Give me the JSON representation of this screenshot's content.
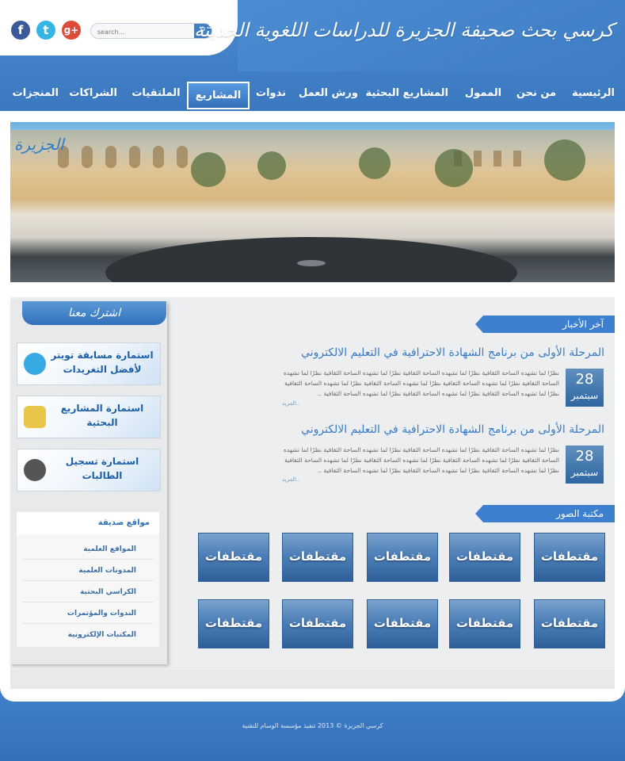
{
  "header": {
    "site_title": "كرسي بحث صحيفة الجزيرة للدراسات اللغوية الحديثة",
    "search_placeholder": "search...",
    "social": {
      "facebook": "f",
      "twitter": "t",
      "googleplus": "g+"
    }
  },
  "nav": {
    "items": [
      {
        "label": "الرئيسية"
      },
      {
        "label": "من نحن"
      },
      {
        "label": "الممول"
      },
      {
        "label": "المشاريع البحثية"
      },
      {
        "label": "ورش العمل"
      },
      {
        "label": "ندوات"
      },
      {
        "label": "المشاريع",
        "active": true
      },
      {
        "label": "الملتقيات"
      },
      {
        "label": "الشراكات"
      },
      {
        "label": "المنجزات"
      }
    ]
  },
  "banner": {
    "logo_text": "الجزيرة"
  },
  "sidebar": {
    "subscribe_label": "اشترك معنا",
    "promos": [
      {
        "text": "استمارة مسابقة تويتر لأفضل التغريدات",
        "icon": "twitter-bird-icon"
      },
      {
        "text": "استمارة المشاريع البحثية",
        "icon": "folder-icon"
      },
      {
        "text": "استمارة تسجيل الطالبات",
        "icon": "film-reel-icon"
      }
    ],
    "links_title": "مواقع صديقة",
    "links": [
      "المواقع العلمية",
      "المدونات العلمية",
      "الكراسي البحثية",
      "الندوات والمؤتمرات",
      "المكتبات الإلكترونية"
    ]
  },
  "news": {
    "section_title": "آخر الأخبار",
    "more_label": "المزيد..",
    "items": [
      {
        "title": "المرحلة الأولى من برنامج الشهادة الاحترافية في التعليم الالكتروني",
        "text": "نظرًا لما تشهده الساحة الثقافية  نظرًا لما تشهده الساحة الثقافية  نظرًا لما تشهده الساحة الثقافية  نظرًا لما تشهده الساحة الثقافية  نظرًا لما تشهده الساحة الثقافية  نظرًا لما تشهده الساحة الثقافية  نظرًا لما تشهده الساحة الثقافية  نظرًا لما تشهده الساحة الثقافية  نظرًا لما تشهده الساحة الثقافية  نظرًا لما تشهده الساحة الثقافية ..",
        "day": "28",
        "month": "سبتمبر"
      },
      {
        "title": "المرحلة الأولى من برنامج الشهادة الاحترافية في التعليم الالكتروني",
        "text": "نظرًا لما تشهده الساحة الثقافية  نظرًا لما تشهده الساحة الثقافية  نظرًا لما تشهده الساحة الثقافية  نظرًا لما تشهده الساحة الثقافية  نظرًا لما تشهده الساحة الثقافية  نظرًا لما تشهده الساحة الثقافية  نظرًا لما تشهده الساحة الثقافية  نظرًا لما تشهده الساحة الثقافية  نظرًا لما تشهده الساحة الثقافية  نظرًا لما تشهده الساحة الثقافية ..",
        "day": "28",
        "month": "سبتمبر"
      }
    ]
  },
  "gallery": {
    "section_title": "مكتبة الصور",
    "tiles": [
      "مقتطفات",
      "مقتطفات",
      "مقتطفات",
      "مقتطفات",
      "مقتطفات",
      "مقتطفات",
      "مقتطفات",
      "مقتطفات",
      "مقتطفات",
      "مقتطفات"
    ]
  },
  "footer": {
    "text": "كرسي الجزيرة © 2013    تنفيذ مؤسسة الوسام للتقنية"
  },
  "colors": {
    "primary": "#3f7fc6",
    "accent": "#3d80d0",
    "link": "#3a7bc4"
  }
}
